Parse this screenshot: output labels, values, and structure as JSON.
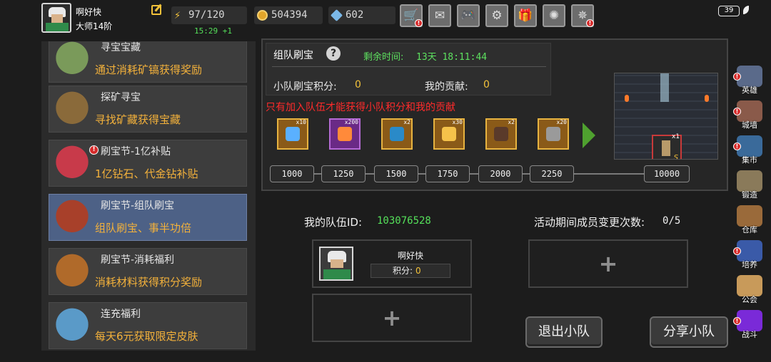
{
  "player": {
    "name": "啊好快",
    "rank": "大师14阶"
  },
  "resources": {
    "energy": "97/120",
    "energy_timer": "15:29 +1",
    "gold": "504394",
    "gems": "602"
  },
  "top_buttons": [
    {
      "icon": "shop-cart-icon",
      "glyph": "🛒",
      "alert": true
    },
    {
      "icon": "mail-icon",
      "glyph": "✉",
      "alert": false
    },
    {
      "icon": "gamepad-icon",
      "glyph": "🎮",
      "alert": false
    },
    {
      "icon": "gear-icon",
      "glyph": "⚙",
      "alert": false
    },
    {
      "icon": "gift-icon",
      "glyph": "🎁",
      "alert": false
    },
    {
      "icon": "pinwheel-icon",
      "glyph": "✺",
      "alert": false
    },
    {
      "icon": "fireworks-icon",
      "glyph": "✵",
      "alert": true
    }
  ],
  "status": {
    "battery": "39"
  },
  "events": [
    {
      "title": "寻宝宝藏",
      "desc": "通过消耗矿镐获得奖励",
      "color": "#7a9a5a"
    },
    {
      "title": "探矿寻宝",
      "desc": "寻找矿藏获得宝藏",
      "color": "#8a6a3a"
    },
    {
      "title": "刷宝节-1亿补贴",
      "desc": "1亿钻石、代金钻补贴",
      "color": "#c83a4a",
      "alert": true
    },
    {
      "title": "刷宝节-组队刷宝",
      "desc": "组队刷宝、事半功倍",
      "color": "#a8402a"
    },
    {
      "title": "刷宝节-消耗福利",
      "desc": "消耗材料获得积分奖励",
      "color": "#b06a2a"
    },
    {
      "title": "连充福利",
      "desc": "每天6元获取限定皮肤",
      "color": "#5a9ac8"
    }
  ],
  "panel": {
    "title": "组队刷宝",
    "remain_label": "剩余时间:",
    "remain_value": "13天  18:11:44",
    "team_score_label": "小队刷宝积分:",
    "team_score": "0",
    "contrib_label": "我的贡献:",
    "contrib": "0",
    "warning": "只有加入队伍才能获得小队积分和我的贡献"
  },
  "rewards": [
    {
      "count": "x10",
      "name": "lightning-scroll-icon",
      "purple": false,
      "glyph_color": "#5ab0ff"
    },
    {
      "count": "x200",
      "name": "fire-claw-icon",
      "purple": true,
      "glyph_color": "#ff8a3a"
    },
    {
      "count": "x2",
      "name": "spellbook-icon",
      "purple": false,
      "glyph_color": "#2a8ac8"
    },
    {
      "count": "x30",
      "name": "golden-egg-icon",
      "purple": false,
      "glyph_color": "#f5c24a"
    },
    {
      "count": "x2",
      "name": "torch-icon",
      "purple": false,
      "glyph_color": "#5a3a2a"
    },
    {
      "count": "x20",
      "name": "hammer-icon",
      "purple": false,
      "glyph_color": "#9a9a9a"
    }
  ],
  "milestones": [
    "1000",
    "1250",
    "1500",
    "1750",
    "2000",
    "2250",
    "10000"
  ],
  "preview": {
    "count": "x1",
    "card": "S"
  },
  "team": {
    "id_label": "我的队伍ID:",
    "id_value": "103076528",
    "change_label": "活动期间成员变更次数:",
    "change_value": "0/5",
    "member": {
      "name": "啊好快",
      "score_label": "积分:",
      "score": "0"
    },
    "plus": "+"
  },
  "buttons": {
    "leave": "退出小队",
    "share": "分享小队"
  },
  "nav": [
    {
      "label": "英雄",
      "icon": "hero-helmet-icon",
      "color": "#5a6a8a",
      "alert": true
    },
    {
      "label": "城墙",
      "icon": "city-wall-icon",
      "color": "#8a5a4a",
      "alert": true
    },
    {
      "label": "集市",
      "icon": "market-icon",
      "color": "#3a6a9a",
      "alert": true
    },
    {
      "label": "锻造",
      "icon": "anvil-hammer-icon",
      "color": "#8a7a5a",
      "alert": false
    },
    {
      "label": "仓库",
      "icon": "warehouse-icon",
      "color": "#9a6a3a",
      "alert": false
    },
    {
      "label": "培养",
      "icon": "trophy-icon",
      "color": "#3a5aa8",
      "alert": true
    },
    {
      "label": "公会",
      "icon": "guild-lion-icon",
      "color": "#c89a5a",
      "alert": false
    },
    {
      "label": "战斗",
      "icon": "battle-portal-icon",
      "color": "#7a2ad8",
      "alert": true
    }
  ]
}
